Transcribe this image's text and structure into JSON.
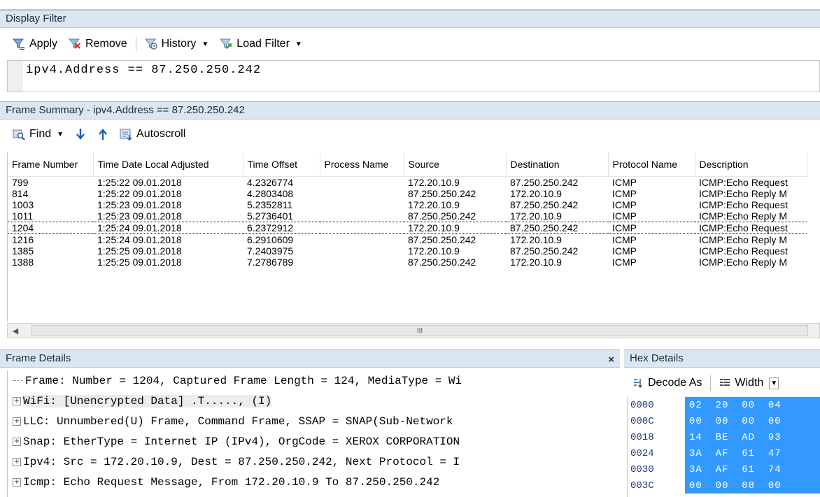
{
  "display_filter": {
    "title": "Display Filter",
    "toolbar": {
      "apply": "Apply",
      "remove": "Remove",
      "history": "History",
      "load_filter": "Load Filter"
    },
    "expression": "ipv4.Address == 87.250.250.242"
  },
  "frame_summary": {
    "title": "Frame Summary - ipv4.Address == 87.250.250.242",
    "toolbar": {
      "find": "Find",
      "autoscroll": "Autoscroll"
    },
    "columns": [
      "Frame Number",
      "Time Date Local Adjusted",
      "Time Offset",
      "Process Name",
      "Source",
      "Destination",
      "Protocol Name",
      "Description"
    ],
    "rows": [
      {
        "frame": "799",
        "time": "1:25:22 09.01.2018",
        "offset": "4.2326774",
        "process": "",
        "source": "172.20.10.9",
        "destination": "87.250.250.242",
        "protocol": "ICMP",
        "description": "ICMP:Echo Request"
      },
      {
        "frame": "814",
        "time": "1:25:22 09.01.2018",
        "offset": "4.2803408",
        "process": "",
        "source": "87.250.250.242",
        "destination": "172.20.10.9",
        "protocol": "ICMP",
        "description": "ICMP:Echo Reply M"
      },
      {
        "frame": "1003",
        "time": "1:25:23 09.01.2018",
        "offset": "5.2352811",
        "process": "",
        "source": "172.20.10.9",
        "destination": "87.250.250.242",
        "protocol": "ICMP",
        "description": "ICMP:Echo Request"
      },
      {
        "frame": "1011",
        "time": "1:25:23 09.01.2018",
        "offset": "5.2736401",
        "process": "",
        "source": "87.250.250.242",
        "destination": "172.20.10.9",
        "protocol": "ICMP",
        "description": "ICMP:Echo Reply M"
      },
      {
        "frame": "1204",
        "time": "1:25:24 09.01.2018",
        "offset": "6.2372912",
        "process": "",
        "source": "172.20.10.9",
        "destination": "87.250.250.242",
        "protocol": "ICMP",
        "description": "ICMP:Echo Request"
      },
      {
        "frame": "1216",
        "time": "1:25:24 09.01.2018",
        "offset": "6.2910609",
        "process": "",
        "source": "87.250.250.242",
        "destination": "172.20.10.9",
        "protocol": "ICMP",
        "description": "ICMP:Echo Reply M"
      },
      {
        "frame": "1385",
        "time": "1:25:25 09.01.2018",
        "offset": "7.2403975",
        "process": "",
        "source": "172.20.10.9",
        "destination": "87.250.250.242",
        "protocol": "ICMP",
        "description": "ICMP:Echo Request"
      },
      {
        "frame": "1388",
        "time": "1:25:25 09.01.2018",
        "offset": "7.2786789",
        "process": "",
        "source": "87.250.250.242",
        "destination": "172.20.10.9",
        "protocol": "ICMP",
        "description": "ICMP:Echo Reply M"
      }
    ],
    "selected_row": 4,
    "scroll_glyph": "III"
  },
  "frame_details": {
    "title": "Frame Details",
    "close": "×",
    "lines": [
      "Frame: Number = 1204, Captured Frame Length = 124, MediaType = Wi",
      "WiFi: [Unencrypted Data] .T....., (I)",
      "LLC: Unnumbered(U) Frame, Command Frame, SSAP = SNAP(Sub-Network",
      "Snap: EtherType = Internet IP (IPv4), OrgCode = XEROX CORPORATION",
      "Ipv4: Src = 172.20.10.9, Dest = 87.250.250.242, Next Protocol = I",
      "Icmp: Echo Request Message, From 172.20.10.9 To 87.250.250.242"
    ]
  },
  "hex_details": {
    "title": "Hex Details",
    "decode_as": "Decode As",
    "width": "Width",
    "rows": [
      {
        "offset": "0000",
        "bytes": "02  20  00  04"
      },
      {
        "offset": "000C",
        "bytes": "00  00  00  00"
      },
      {
        "offset": "0018",
        "bytes": "14  BE  AD  93"
      },
      {
        "offset": "0024",
        "bytes": "3A  AF  61  47"
      },
      {
        "offset": "0030",
        "bytes": "3A  AF  61  74"
      },
      {
        "offset": "003C",
        "bytes": "00  00  08  00"
      }
    ]
  },
  "colors": {
    "pane_header": "#dbe6f3",
    "hex_selection": "#3399ff"
  }
}
